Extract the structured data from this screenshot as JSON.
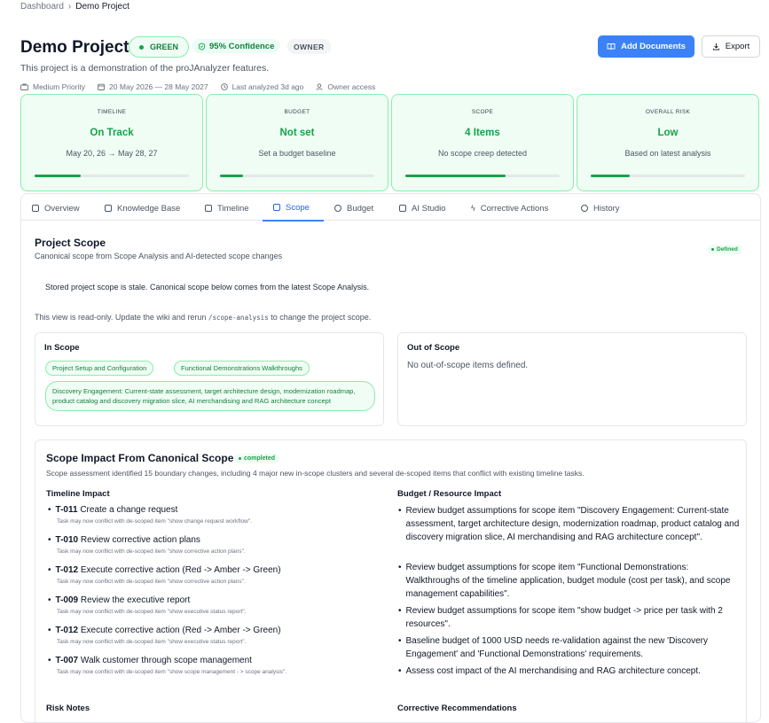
{
  "breadcrumb": {
    "root": "Dashboard",
    "separator": "›",
    "current": "Demo Project"
  },
  "header": {
    "title": "Demo Project",
    "status": "GREEN",
    "confidence": "95% Confidence",
    "role": "OWNER",
    "add_documents": "Add Documents",
    "export": "Export",
    "description": "This project is a demonstration of the proJAnalyzer features.",
    "meta": {
      "priority": "Medium Priority",
      "dates": "20 May 2026 — 28 May 2027",
      "analyzed": "Last analyzed 3d ago",
      "access": "Owner access"
    }
  },
  "cards": [
    {
      "label": "TIMELINE",
      "value": "On Track",
      "sub": "May 20, 26 → May 28, 27",
      "progress": 0.3
    },
    {
      "label": "BUDGET",
      "value": "Not set",
      "sub": "Set a budget baseline",
      "progress": 0.15
    },
    {
      "label": "SCOPE",
      "value": "4 Items",
      "sub": "No scope creep detected",
      "progress": 0.65
    },
    {
      "label": "OVERALL RISK",
      "value": "Low",
      "sub": "Based on latest analysis",
      "progress": 0.25
    }
  ],
  "tabs": [
    {
      "label": "Overview",
      "icon": "document-icon"
    },
    {
      "label": "Knowledge Base",
      "icon": "book-icon"
    },
    {
      "label": "Timeline",
      "icon": "calendar-icon"
    },
    {
      "label": "Scope",
      "icon": "clipboard-icon",
      "active": true
    },
    {
      "label": "Budget",
      "icon": "coin-icon"
    },
    {
      "label": "AI Studio",
      "icon": "monitor-icon"
    },
    {
      "label": "Corrective Actions",
      "icon": "bolt-icon"
    },
    {
      "label": "History",
      "icon": "clock-icon"
    }
  ],
  "scope": {
    "title": "Project Scope",
    "subtitle": "Canonical scope from Scope Analysis and AI-detected scope changes",
    "badge": "Defined",
    "stale_notice": "Stored project scope is stale. Canonical scope below comes from the latest Scope Analysis.",
    "readonly_prefix": "This view is read-only. Update the wiki and rerun",
    "readonly_code": "/scope-analysis",
    "readonly_suffix": "to change the project scope.",
    "in_scope_title": "In Scope",
    "in_scope_items": [
      "Project Setup and Configuration",
      "Functional Demonstrations Walkthroughs",
      "Discovery Engagement: Current-state assessment, target architecture design, modernization roadmap, product catalog and discovery migration slice, AI merchandising and RAG architecture concept"
    ],
    "out_scope_title": "Out of Scope",
    "out_scope_empty": "No out-of-scope items defined."
  },
  "impact": {
    "title": "Scope Impact From Canonical Scope",
    "badge": "completed",
    "subtitle": "Scope assessment identified 15 boundary changes, including 4 major new in-scope clusters and several de-scoped items that conflict with existing timeline tasks.",
    "timeline_title": "Timeline Impact",
    "timeline": [
      {
        "id": "T-011",
        "text": "Create a change request",
        "note": "Task may now conflict with de-scoped item \"show change request workflow\"."
      },
      {
        "id": "T-010",
        "text": "Review corrective action plans",
        "note": "Task may now conflict with de-scoped item \"show corrective action plans\"."
      },
      {
        "id": "T-012",
        "text": "Execute corrective action (Red -> Amber -> Green)",
        "note": "Task may now conflict with de-scoped item \"show corrective action plans\"."
      },
      {
        "id": "T-009",
        "text": "Review the executive report",
        "note": "Task may now conflict with de-scoped item \"show executive status report\"."
      },
      {
        "id": "T-012",
        "text": "Execute corrective action (Red -> Amber -> Green)",
        "note": "Task may now conflict with de-scoped item \"show executive status report\"."
      },
      {
        "id": "T-007",
        "text": "Walk customer through scope management",
        "note": "Task may now conflict with de-scoped item \"show scope management - > scope analysis\"."
      }
    ],
    "budget_title": "Budget / Resource Impact",
    "budget": [
      "Review budget assumptions for scope item \"Discovery Engagement: Current-state assessment, target architecture design, modernization roadmap, product catalog and discovery migration slice, AI merchandising and RAG architecture concept\".",
      "Review budget assumptions for scope item \"Functional Demonstrations: Walkthroughs of the timeline application, budget module (cost per task), and scope management capabilities\".",
      "Review budget assumptions for scope item \"show budget -> price per task with 2 resources\".",
      "Baseline budget of 1000 USD needs re-validation against the new 'Discovery Engagement' and 'Functional Demonstrations' requirements.",
      "Assess cost impact of the AI merchandising and RAG architecture concept."
    ],
    "risk_title": "Risk Notes",
    "corrective_title": "Corrective Recommendations"
  }
}
